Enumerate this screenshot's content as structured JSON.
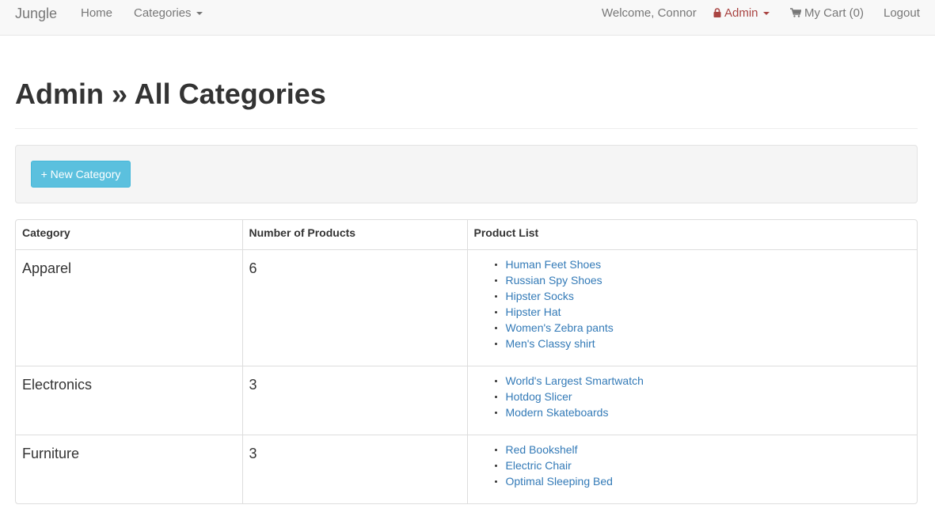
{
  "navbar": {
    "brand": "Jungle",
    "home": "Home",
    "categories": "Categories",
    "welcome": "Welcome, Connor",
    "admin": "Admin",
    "cart": "My Cart (0)",
    "logout": "Logout",
    "colors": {
      "admin": "#a94442",
      "link": "#337ab7",
      "button": "#5bc0de"
    },
    "icons": {
      "admin": "lock-icon",
      "cart": "shopping-cart-icon"
    }
  },
  "page": {
    "title": "Admin » All Categories"
  },
  "actions": {
    "new_category": "+ New Category"
  },
  "table": {
    "headers": [
      "Category",
      "Number of Products",
      "Product List"
    ],
    "rows": [
      {
        "category": "Apparel",
        "count": "6",
        "products": [
          "Human Feet Shoes",
          "Russian Spy Shoes",
          "Hipster Socks",
          "Hipster Hat",
          "Women's Zebra pants",
          "Men's Classy shirt"
        ]
      },
      {
        "category": "Electronics",
        "count": "3",
        "products": [
          "World's Largest Smartwatch",
          "Hotdog Slicer",
          "Modern Skateboards"
        ]
      },
      {
        "category": "Furniture",
        "count": "3",
        "products": [
          "Red Bookshelf",
          "Electric Chair",
          "Optimal Sleeping Bed"
        ]
      }
    ]
  }
}
